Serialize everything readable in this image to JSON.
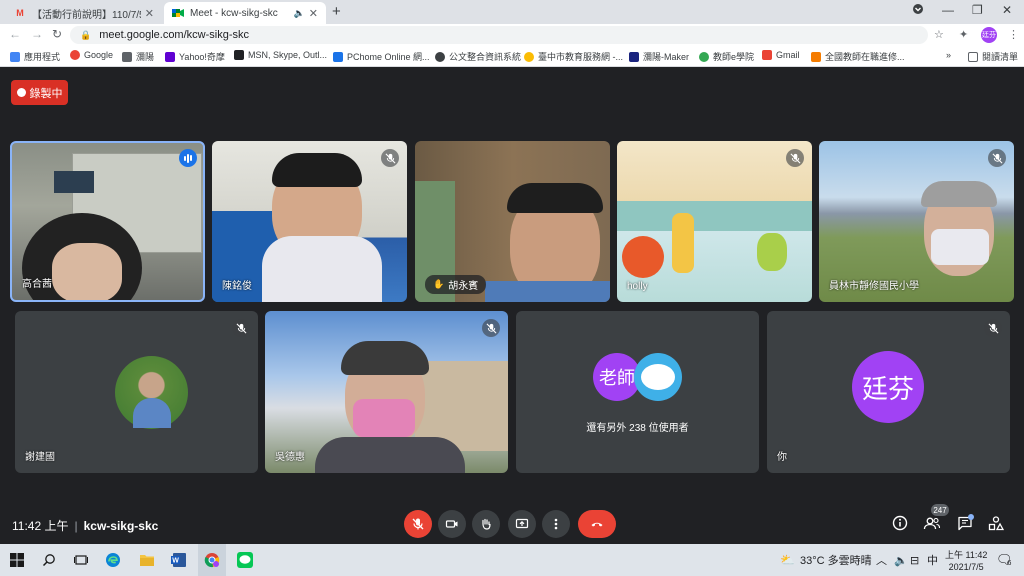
{
  "browser": {
    "tabs": [
      {
        "title": "【活動行前說明】110/7/5『圖",
        "active": false
      },
      {
        "title": "Meet - kcw-sikg-skc",
        "active": true
      }
    ],
    "url": "meet.google.com/kcw-sikg-skc",
    "profile_initials": "廷芬",
    "bookmarks": [
      "應用程式",
      "Google",
      "瀰陽",
      "Yahoo!奇摩",
      "MSN, Skype, Outl...",
      "PChome Online 網...",
      "公文整合資訊系統",
      "臺中市教育服務網 -...",
      "瀰陽-Maker",
      "教師e學院",
      "Gmail",
      "全國教師在職進修..."
    ],
    "reading_list": "閱讀清單"
  },
  "meet": {
    "recording_label": "錄製中",
    "participants": [
      {
        "name": "高合茜"
      },
      {
        "name": "陳銘俊"
      },
      {
        "name": "胡永賓"
      },
      {
        "name": "holly"
      },
      {
        "name": "員林市靜修國民小學"
      },
      {
        "name": "謝建國"
      },
      {
        "name": "吳德惠"
      },
      {
        "name": "還有另外 238 位使用者",
        "avatar1": "老師"
      },
      {
        "name": "你",
        "avatar": "廷芬"
      }
    ],
    "time": "11:42 上午",
    "meeting_code": "kcw-sikg-skc",
    "people_count": "247"
  },
  "taskbar": {
    "weather": "33°C 多雲時晴",
    "ime": "中",
    "time": "上午 11:42",
    "date": "2021/7/5",
    "notifications": "6"
  }
}
